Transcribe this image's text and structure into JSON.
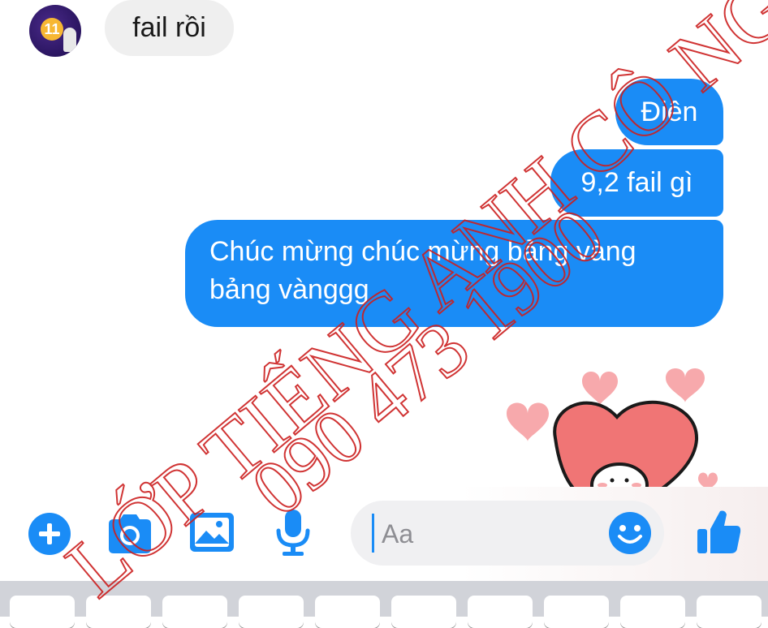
{
  "messages": {
    "incoming": [
      {
        "text": "fail rồi"
      }
    ],
    "outgoing": [
      {
        "text": "Điên"
      },
      {
        "text": "9,2 fail gì"
      },
      {
        "text": "Chúc mừng chúc mừng bảng vàng bảng vànggg"
      }
    ]
  },
  "avatar": {
    "badge": "11"
  },
  "composer": {
    "placeholder": "Aa"
  },
  "toolbar": {
    "icons": [
      "plus-icon",
      "camera-icon",
      "image-icon",
      "microphone-icon",
      "emoji-icon",
      "thumbs-up-icon"
    ]
  },
  "watermark": {
    "line1": "LỚP TIẾNG ANH CÔ NGÂN",
    "line2": "090 473 1900"
  },
  "colors": {
    "accent": "#1a8cf6",
    "incoming_bubble": "#efefef",
    "watermark": "#cc1f1f",
    "heart": "#f07575",
    "heart_light": "#f7a9ac"
  }
}
